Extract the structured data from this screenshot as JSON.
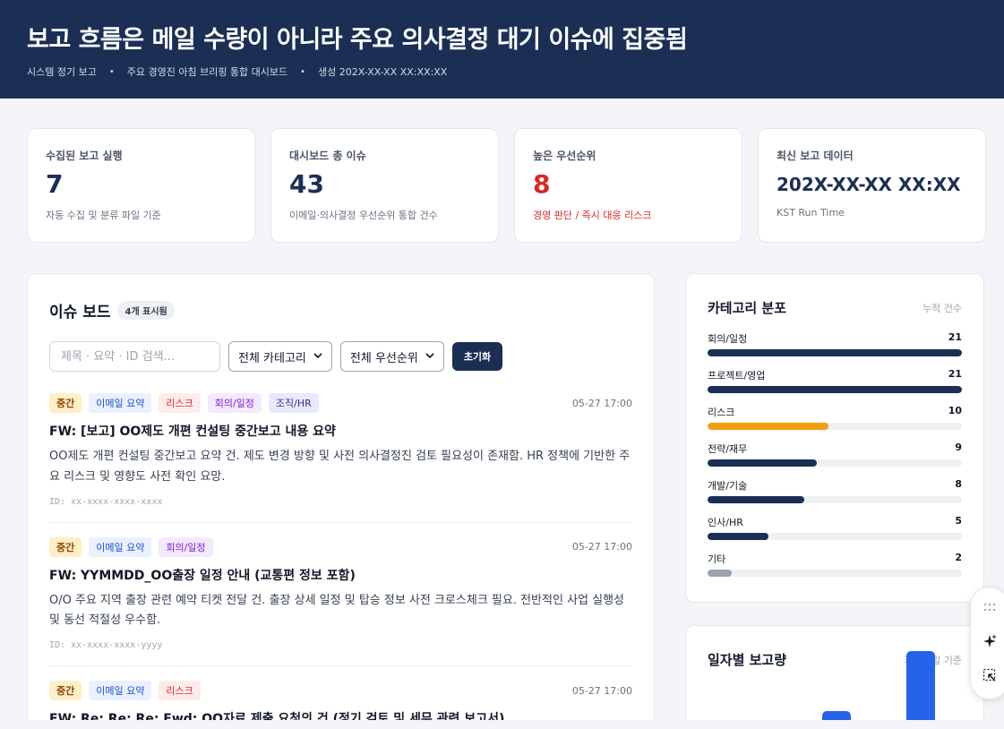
{
  "header": {
    "title": "보고 흐름은 메일 수량이 아니라 주요 의사결정 대기 이슈에 집중됨",
    "meta": [
      "시스템 정기 보고",
      "주요 경영진 아침 브리핑 통합 대시보드",
      "생성 202X-XX-XX XX:XX:XX"
    ]
  },
  "kpis": [
    {
      "label": "수집된 보고 실행",
      "value": "7",
      "sub": "자동 수집 및 분류 파일 기준"
    },
    {
      "label": "대시보드 총 이슈",
      "value": "43",
      "sub": "이메일·의사결정 우선순위 통합 건수"
    },
    {
      "label": "높은 우선순위",
      "value": "8",
      "sub": "경영 판단 / 즉시 대응 리스크"
    },
    {
      "label": "최신 보고 데이터",
      "value": "202X-XX-XX XX:XX",
      "sub": "KST Run Time"
    }
  ],
  "board": {
    "title": "이슈 보드",
    "count_badge": "4개 표시됨",
    "search_placeholder": "제목 · 요약 · ID 검색...",
    "category_select": "전체 카테고리",
    "priority_select": "전체 우선순위",
    "reset_label": "초기화",
    "issues": [
      {
        "tags": [
          "중간",
          "이메일 요약",
          "리스크",
          "회의/일정",
          "조직/HR"
        ],
        "time": "05-27 17:00",
        "title": "FW: [보고] OO제도 개편 컨설팅 중간보고 내용 요약",
        "summary": "OO제도 개편 컨설팅 중간보고 요약 건. 제도 변경 방향 및 사전 의사결정진 검토 필요성이 존재함. HR 정책에 기반한 주요 리스크 및 영향도 사전 확인 요망.",
        "id": "ID: xx-xxxx-xxxx-xxxx"
      },
      {
        "tags": [
          "중간",
          "이메일 요약",
          "회의/일정"
        ],
        "time": "05-27 17:00",
        "title": "FW: YYMMDD_OO출장 일정 안내 (교통편 정보 포함)",
        "summary": "O/O 주요 지역 출장 관련 예약 티켓 전달 건. 출장 상세 일정 및 탑승 정보 사전 크로스체크 필요. 전반적인 사업 실행성 및 동선 적절성 우수함.",
        "id": "ID: xx-xxxx-xxxx-yyyy"
      },
      {
        "tags": [
          "중간",
          "이메일 요약",
          "리스크"
        ],
        "time": "05-27 17:00",
        "title": "FW: Re: Re: Re: Fwd: OO자료 제출 요청의 건 (정기 검토 및 세무 관련 보고서)",
        "summary": "",
        "id": ""
      }
    ]
  },
  "categories": {
    "title": "카테고리 분포",
    "note": "누적 건수",
    "max": 21,
    "items": [
      {
        "name": "회의/일정",
        "count": 21,
        "color": "#1b2f55"
      },
      {
        "name": "프로젝트/영업",
        "count": 21,
        "color": "#1b2f55"
      },
      {
        "name": "리스크",
        "count": 10,
        "color": "#f59e0b"
      },
      {
        "name": "전략/재무",
        "count": 9,
        "color": "#1b2f55"
      },
      {
        "name": "개발/기술",
        "count": 8,
        "color": "#1b2f55"
      },
      {
        "name": "인사/HR",
        "count": 5,
        "color": "#1b2f55"
      },
      {
        "name": "기타",
        "count": 2,
        "color": "#9ca3af"
      }
    ]
  },
  "daily": {
    "title": "일자별 보고량",
    "note": "최근 3일 기준",
    "values": [
      0,
      1,
      6
    ],
    "bar_color": "#2563eb"
  }
}
